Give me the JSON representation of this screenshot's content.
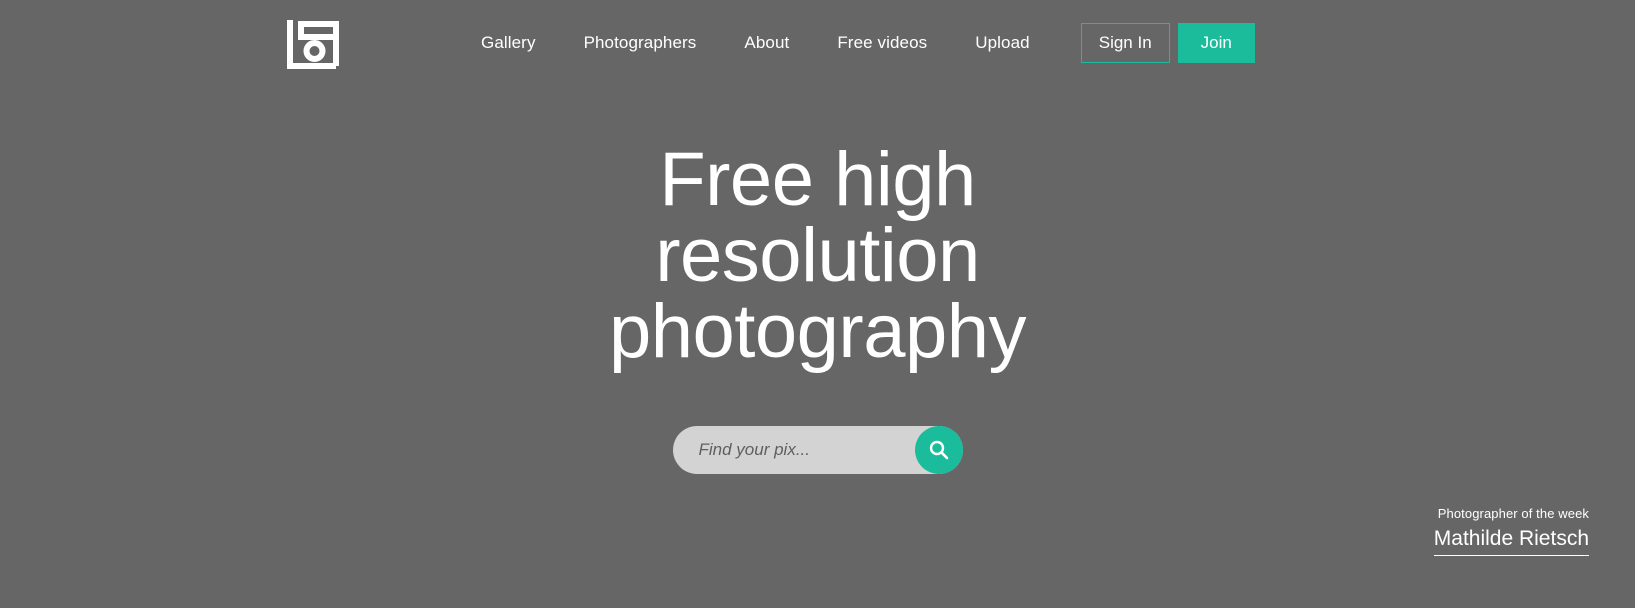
{
  "theme": {
    "background": "#666666",
    "accent": "#1abc9c",
    "text_on_dark": "#ffffff",
    "search_field_bg": "#d3d3d3",
    "search_placeholder_color": "#5f5f5f"
  },
  "header": {
    "logo": {
      "icon": "camera-frame-logo-icon",
      "alt": "Site logo"
    },
    "nav": [
      {
        "label": "Gallery",
        "name": "nav-link-gallery"
      },
      {
        "label": "Photographers",
        "name": "nav-link-photographers"
      },
      {
        "label": "About",
        "name": "nav-link-about"
      },
      {
        "label": "Free videos",
        "name": "nav-link-free-videos"
      },
      {
        "label": "Upload",
        "name": "nav-link-upload"
      }
    ],
    "sign_in_label": "Sign In",
    "join_label": "Join"
  },
  "hero": {
    "title_line_1": "Free high",
    "title_line_2": "resolution",
    "title_line_3": "photography",
    "title_full": "Free high resolution photography"
  },
  "search": {
    "placeholder": "Find your pix...",
    "value": "",
    "button_icon": "search-icon"
  },
  "photographer_of_week": {
    "label": "Photographer of the week",
    "name": "Mathilde Rietsch"
  }
}
